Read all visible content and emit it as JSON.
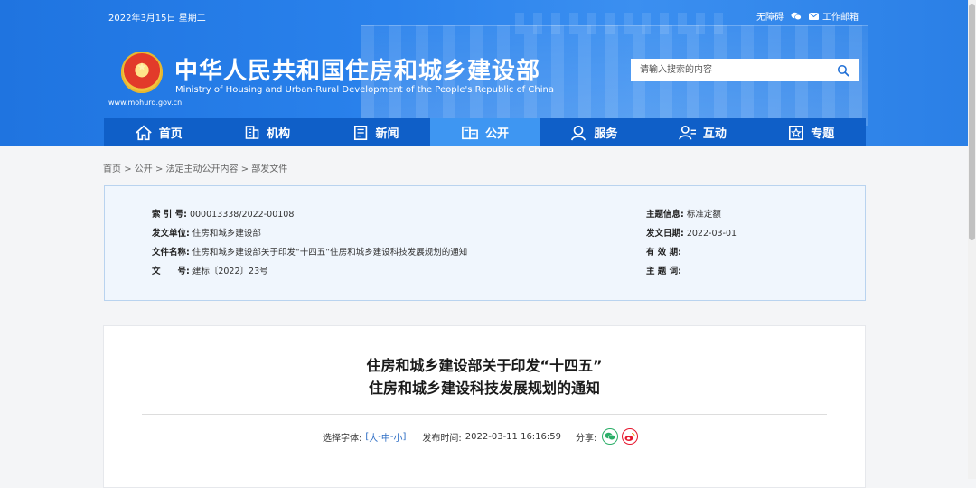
{
  "topbar": {
    "date": "2022年3月15日 星期二",
    "accessibility": "无障碍",
    "mail": "工作邮箱"
  },
  "header": {
    "title": "中华人民共和国住房和城乡建设部",
    "subtitle": "Ministry of Housing and Urban-Rural Development of the People's Republic of China",
    "url": "www.mohurd.gov.cn",
    "search_placeholder": "请输入搜索的内容"
  },
  "nav": {
    "items": [
      {
        "label": "首页",
        "icon": "home-icon"
      },
      {
        "label": "机构",
        "icon": "building-icon"
      },
      {
        "label": "新闻",
        "icon": "news-icon"
      },
      {
        "label": "公开",
        "icon": "disclosure-icon",
        "active": true
      },
      {
        "label": "服务",
        "icon": "service-icon"
      },
      {
        "label": "互动",
        "icon": "interact-icon"
      },
      {
        "label": "专题",
        "icon": "topic-icon"
      }
    ]
  },
  "breadcrumb": {
    "items": [
      "首页",
      "公开",
      "法定主动公开内容",
      "部发文件"
    ],
    "separator": ">"
  },
  "meta": {
    "index_label": "索 引 号:",
    "index_value": "000013338/2022-00108",
    "issuer_label": "发文单位:",
    "issuer_value": "住房和城乡建设部",
    "name_label": "文件名称:",
    "name_value": "住房和城乡建设部关于印发“十四五”住房和城乡建设科技发展规划的通知",
    "doc_label": "文　　号:",
    "doc_value": "建标〔2022〕23号",
    "subject_label": "主题信息:",
    "subject_value": "标准定额",
    "date_label": "发文日期:",
    "date_value": "2022-03-01",
    "validity_label": "有 效 期:",
    "validity_value": "",
    "keywords_label": "主 题 词:",
    "keywords_value": ""
  },
  "article": {
    "title_line1": "住房和城乡建设部关于印发“十四五”",
    "title_line2": "住房和城乡建设科技发展规划的通知",
    "font_label": "选择字体:",
    "font_open": "[",
    "font_large": "大",
    "font_medium": "中",
    "font_small": "小",
    "font_dash": "-",
    "font_close": "]",
    "publish_label": "发布时间:",
    "publish_time": "2022-03-11 16:16:59",
    "share_label": "分享:"
  },
  "colors": {
    "header_blue": "#2a82ec",
    "nav_blue": "#0f5fc8",
    "nav_active": "#3e96f2",
    "wechat_green": "#2aae67",
    "weibo_red": "#e6162d"
  }
}
